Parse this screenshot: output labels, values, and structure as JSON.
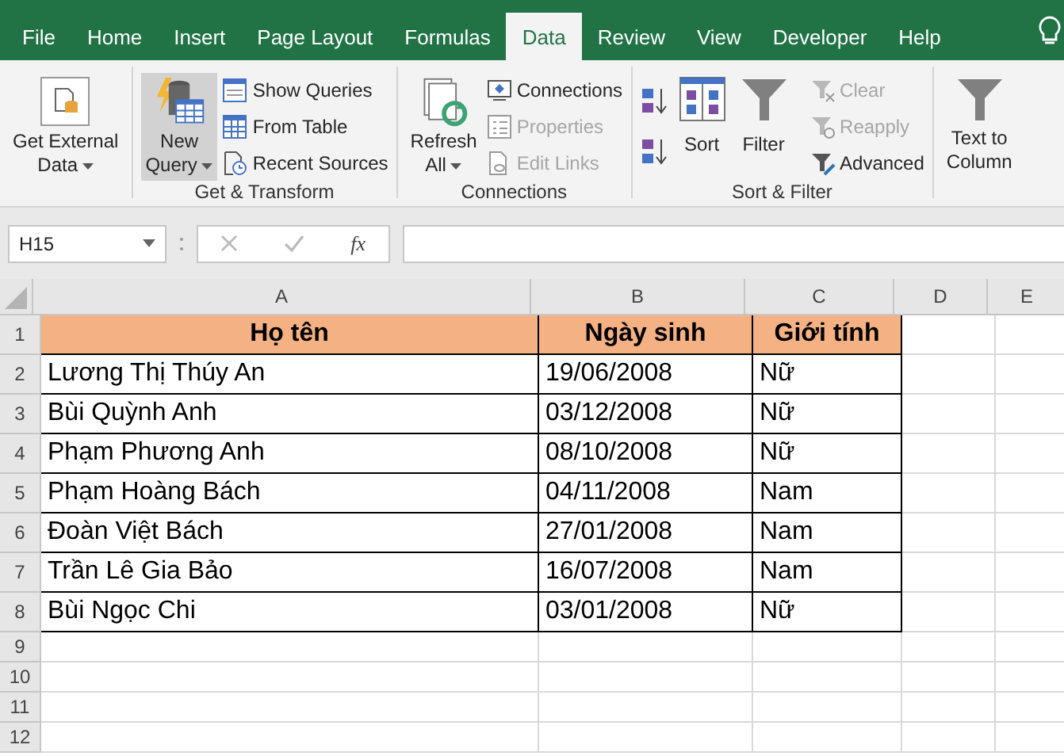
{
  "tabs": [
    {
      "label": "File",
      "selected": false
    },
    {
      "label": "Home",
      "selected": false
    },
    {
      "label": "Insert",
      "selected": false
    },
    {
      "label": "Page Layout",
      "selected": false
    },
    {
      "label": "Formulas",
      "selected": false
    },
    {
      "label": "Data",
      "selected": true
    },
    {
      "label": "Review",
      "selected": false
    },
    {
      "label": "View",
      "selected": false
    },
    {
      "label": "Developer",
      "selected": false
    },
    {
      "label": "Help",
      "selected": false
    }
  ],
  "ribbon": {
    "groups": [
      {
        "columns": [
          {
            "kind": "large",
            "lines": [
              "Get External",
              "Data"
            ],
            "dropdown": true,
            "highlighted": false,
            "disabled": false
          }
        ]
      },
      {
        "label": "Get & Transform",
        "columns": [
          {
            "kind": "large",
            "lines": [
              "New",
              "Query"
            ],
            "dropdown": true,
            "highlighted": true,
            "disabled": false
          },
          {
            "kind": "stack",
            "items": [
              {
                "label": "Show Queries",
                "disabled": false
              },
              {
                "label": "From Table",
                "disabled": false
              },
              {
                "label": "Recent Sources",
                "disabled": false
              }
            ]
          }
        ]
      },
      {
        "label": "Connections",
        "columns": [
          {
            "kind": "large",
            "lines": [
              "Refresh",
              "All"
            ],
            "dropdown": true,
            "highlighted": false,
            "disabled": false
          },
          {
            "kind": "stack",
            "items": [
              {
                "label": "Connections",
                "disabled": false
              },
              {
                "label": "Properties",
                "disabled": true
              },
              {
                "label": "Edit Links",
                "disabled": true
              }
            ]
          }
        ]
      },
      {
        "label": "Sort & Filter",
        "columns": [
          {
            "kind": "sortbuttons"
          },
          {
            "kind": "large",
            "lines": [
              "Sort"
            ],
            "dropdown": false,
            "highlighted": false,
            "disabled": false
          },
          {
            "kind": "large",
            "lines": [
              "Filter"
            ],
            "dropdown": false,
            "highlighted": false,
            "disabled": false
          },
          {
            "kind": "stack",
            "items": [
              {
                "label": "Clear",
                "disabled": true
              },
              {
                "label": "Reapply",
                "disabled": true
              },
              {
                "label": "Advanced",
                "disabled": false
              }
            ]
          }
        ]
      },
      {
        "columns": [
          {
            "kind": "large",
            "lines": [
              "Text to",
              "Column"
            ],
            "dropdown": false,
            "highlighted": false,
            "disabled": false
          }
        ]
      }
    ]
  },
  "formula_bar": {
    "name_box": "H15",
    "function_label": "fx"
  },
  "sheet": {
    "columns": [
      "A",
      "B",
      "C",
      "D",
      "E"
    ],
    "rows": [
      {
        "number": "1",
        "kind": "header",
        "cells": [
          "Họ tên",
          "Ngày sinh",
          "Giới tính"
        ]
      },
      {
        "number": "2",
        "kind": "data",
        "cells": [
          "Lương Thị Thúy An",
          "19/06/2008",
          "Nữ"
        ]
      },
      {
        "number": "3",
        "kind": "data",
        "cells": [
          "Bùi Quỳnh Anh",
          "03/12/2008",
          "Nữ"
        ]
      },
      {
        "number": "4",
        "kind": "data",
        "cells": [
          "Phạm Phương Anh",
          "08/10/2008",
          "Nữ"
        ]
      },
      {
        "number": "5",
        "kind": "data",
        "cells": [
          "Phạm Hoàng Bách",
          "04/11/2008",
          "Nam"
        ]
      },
      {
        "number": "6",
        "kind": "data",
        "cells": [
          "Đoàn Việt Bách",
          "27/01/2008",
          "Nam"
        ]
      },
      {
        "number": "7",
        "kind": "data",
        "cells": [
          "Trần Lê Gia Bảo",
          "16/07/2008",
          "Nam"
        ]
      },
      {
        "number": "8",
        "kind": "data",
        "cells": [
          "Bùi Ngọc Chi",
          "03/01/2008",
          "Nữ"
        ]
      },
      {
        "number": "9",
        "kind": "empty"
      },
      {
        "number": "10",
        "kind": "empty"
      },
      {
        "number": "11",
        "kind": "empty"
      },
      {
        "number": "12",
        "kind": "empty"
      }
    ]
  }
}
